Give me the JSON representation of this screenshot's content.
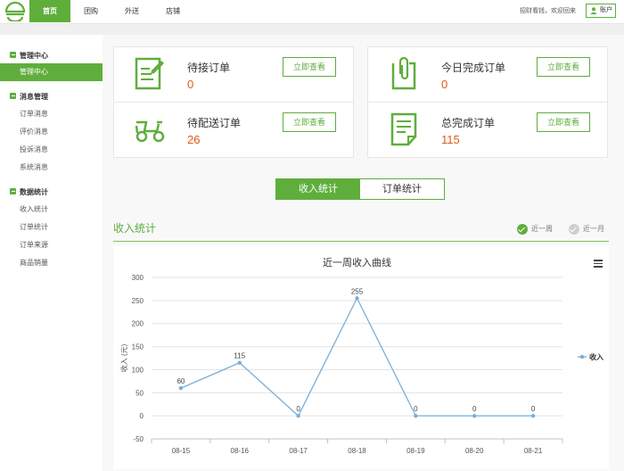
{
  "nav": {
    "items": [
      "首页",
      "团购",
      "外送",
      "店铺"
    ],
    "active_index": 0
  },
  "header": {
    "welcome": "招财看钱，欢迎回来",
    "account_label": "账户"
  },
  "sidebar": {
    "groups": [
      {
        "title": "管理中心",
        "items": [
          "管理中心"
        ]
      },
      {
        "title": "消息管理",
        "items": [
          "订单消息",
          "评价消息",
          "投诉消息",
          "系统消息"
        ]
      },
      {
        "title": "数据统计",
        "items": [
          "收入统计",
          "订单统计",
          "订单来源",
          "商品销量"
        ]
      }
    ],
    "active_item": "管理中心"
  },
  "stats": [
    {
      "label": "待接订单",
      "value": "0",
      "button": "立即查看",
      "icon": "edit-document-icon"
    },
    {
      "label": "今日完成订单",
      "value": "0",
      "button": "立即查看",
      "icon": "clipboard-icon"
    },
    {
      "label": "待配送订单",
      "value": "26",
      "button": "立即查看",
      "icon": "scooter-icon"
    },
    {
      "label": "总完成订单",
      "value": "115",
      "button": "立即查看",
      "icon": "document-list-icon"
    }
  ],
  "tabs": [
    "收入统计",
    "订单统计"
  ],
  "active_tab": 0,
  "section": {
    "title": "收入统计",
    "range_week": "近一周",
    "range_month": "近一月"
  },
  "colors": {
    "accent": "#5fae3c",
    "value_orange": "#e05a1a",
    "series_line": "#7aaed8"
  },
  "chart_data": {
    "type": "line",
    "title": "近一周收入曲线",
    "ylabel": "收入 (元)",
    "xlabel": "",
    "categories": [
      "08-15",
      "08-16",
      "08-17",
      "08-18",
      "08-19",
      "08-20",
      "08-21"
    ],
    "series": [
      {
        "name": "收入",
        "values": [
          60,
          115,
          0,
          255,
          0,
          0,
          0
        ]
      }
    ],
    "ylim": [
      -50,
      300
    ],
    "yticks": [
      300,
      250,
      200,
      150,
      100,
      50,
      0,
      -50
    ],
    "grid": true,
    "legend": "right"
  }
}
